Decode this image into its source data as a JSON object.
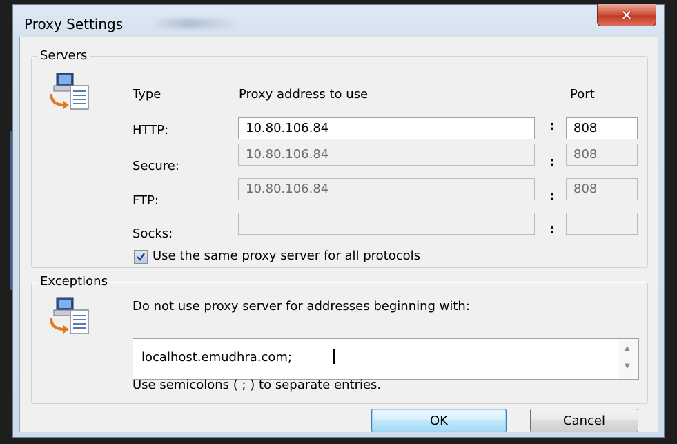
{
  "window": {
    "title": "Proxy Settings",
    "close_glyph": "✕"
  },
  "servers": {
    "legend": "Servers",
    "icon": "network-computer-icon",
    "headers": {
      "type": "Type",
      "address": "Proxy address to use",
      "port": "Port"
    },
    "colon": ":",
    "rows": [
      {
        "label": "HTTP:",
        "address": "10.80.106.84",
        "port": "808",
        "enabled": true
      },
      {
        "label": "Secure:",
        "address": "10.80.106.84",
        "port": "808",
        "enabled": false
      },
      {
        "label": "FTP:",
        "address": "10.80.106.84",
        "port": "808",
        "enabled": false
      },
      {
        "label": "Socks:",
        "address": "",
        "port": "",
        "enabled": false
      }
    ],
    "same_proxy": {
      "label": "Use the same proxy server for all protocols",
      "checked": true
    }
  },
  "exceptions": {
    "legend": "Exceptions",
    "icon": "network-computer-icon",
    "description": "Do not use proxy server for addresses beginning with:",
    "value": "localhost.emudhra.com;",
    "hint": "Use semicolons ( ; ) to separate entries."
  },
  "buttons": {
    "ok": "OK",
    "cancel": "Cancel"
  },
  "colors": {
    "title_bg": "#d3e0ee",
    "close_red": "#c33a24",
    "client_bg": "#f0f0f0",
    "ok_blue": "#bee6fd"
  }
}
